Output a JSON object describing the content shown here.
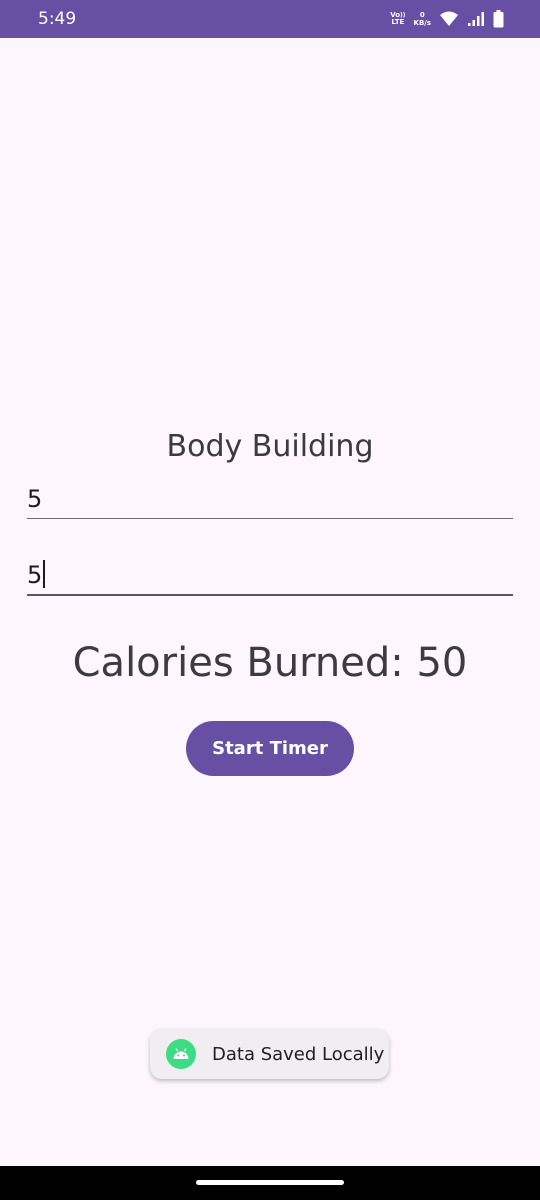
{
  "status_bar": {
    "time": "5:49",
    "network_label_top": "VoLTE",
    "network_label_bottom": "LTE",
    "speed_value": "0",
    "speed_unit": "KB/s",
    "icons": [
      "volte-icon",
      "wifi-icon",
      "signal-icon",
      "battery-icon"
    ],
    "color": "#6750A4"
  },
  "screen": {
    "title": "Body Building",
    "field_1_value": "5",
    "field_2_value": "5",
    "calories_text": "Calories Burned: 50"
  },
  "actions": {
    "start_timer_label": "Start Timer"
  },
  "toast": {
    "text": "Data Saved Locally",
    "icon": "android-icon"
  },
  "colors": {
    "primary": "#6750A4",
    "background": "#FDF7FD",
    "toast_icon": "#3DDC84"
  }
}
